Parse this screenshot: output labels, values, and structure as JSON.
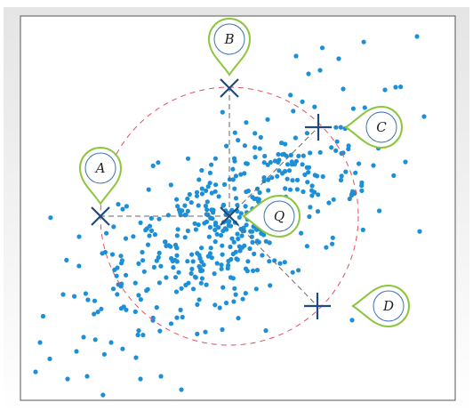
{
  "labels": {
    "a": "A",
    "b": "B",
    "c": "C",
    "d": "D",
    "q": "Q"
  },
  "colors": {
    "frame": "#555555",
    "shadow": "#d9d9d9",
    "points": "#1c8fd6",
    "marker": "#1f4a7a",
    "circle": "#e05060",
    "dashes": "#666666",
    "pin_fill": "#ffffff",
    "pin_outline": "#8cc63f",
    "pin_ring": "#3a6fb0"
  }
}
